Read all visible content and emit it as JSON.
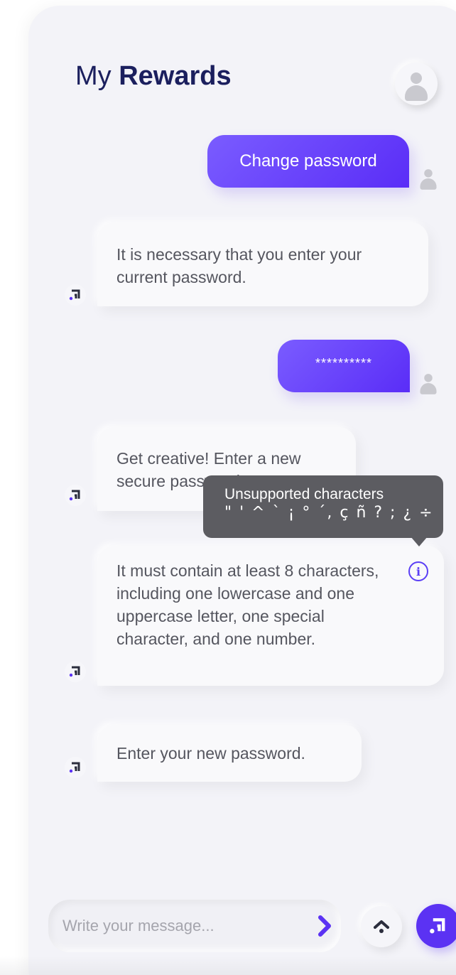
{
  "header": {
    "title_regular": "My",
    "title_bold": "Rewards"
  },
  "messages": [
    {
      "from": "user",
      "text": "Change password"
    },
    {
      "from": "bot",
      "text": "It is necessary that you enter your current password."
    },
    {
      "from": "user",
      "text": "**********"
    },
    {
      "from": "bot",
      "text": "Get creative! Enter a new secure password."
    },
    {
      "from": "bot",
      "text": "It must contain at least 8 characters, including one lowercase and one uppercase letter, one special character, and one number."
    },
    {
      "from": "bot",
      "text": "Enter your new password."
    }
  ],
  "tooltip": {
    "title": "Unsupported characters",
    "chars": "\" ' ^ ` ¡ ° ´, ç ñ ? ; ¿ ÷"
  },
  "composer": {
    "placeholder": "Write your message..."
  },
  "colors": {
    "accent": "#5b32f3",
    "title": "#1b1f5e",
    "tooltip_bg": "#5c5c61"
  },
  "icons": [
    "user-avatar-icon",
    "bot-logo-icon",
    "info-icon",
    "send-chevron-icon",
    "chevron-up-icon"
  ]
}
